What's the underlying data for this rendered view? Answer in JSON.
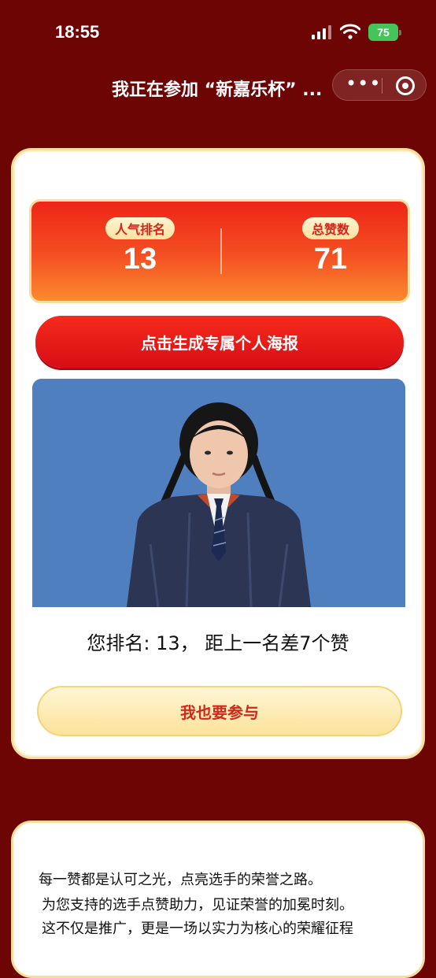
{
  "status": {
    "time": "18:55",
    "battery": "75"
  },
  "nav": {
    "title": "我正在参加 “新嘉乐杯” ..."
  },
  "stats": {
    "popularity_label": "人气排名",
    "popularity_value": "13",
    "likes_label": "总赞数",
    "likes_value": "71"
  },
  "poster_button": "点击生成专属个人海报",
  "rank_text": "您排名: 13，   距上一名差7个赞",
  "join_button": "我也要参与",
  "description": {
    "line1": "每一赞都是认可之光，点亮选手的荣誉之路。",
    "line2": "为您支持的选手点赞助力，见证荣誉的加冕时刻。",
    "line3": "这不仅是推广，更是一场以实力为核心的荣耀征程"
  },
  "colors": {
    "background": "#6e0505",
    "accent": "#e81f17",
    "gold": "#f7dd9b"
  }
}
